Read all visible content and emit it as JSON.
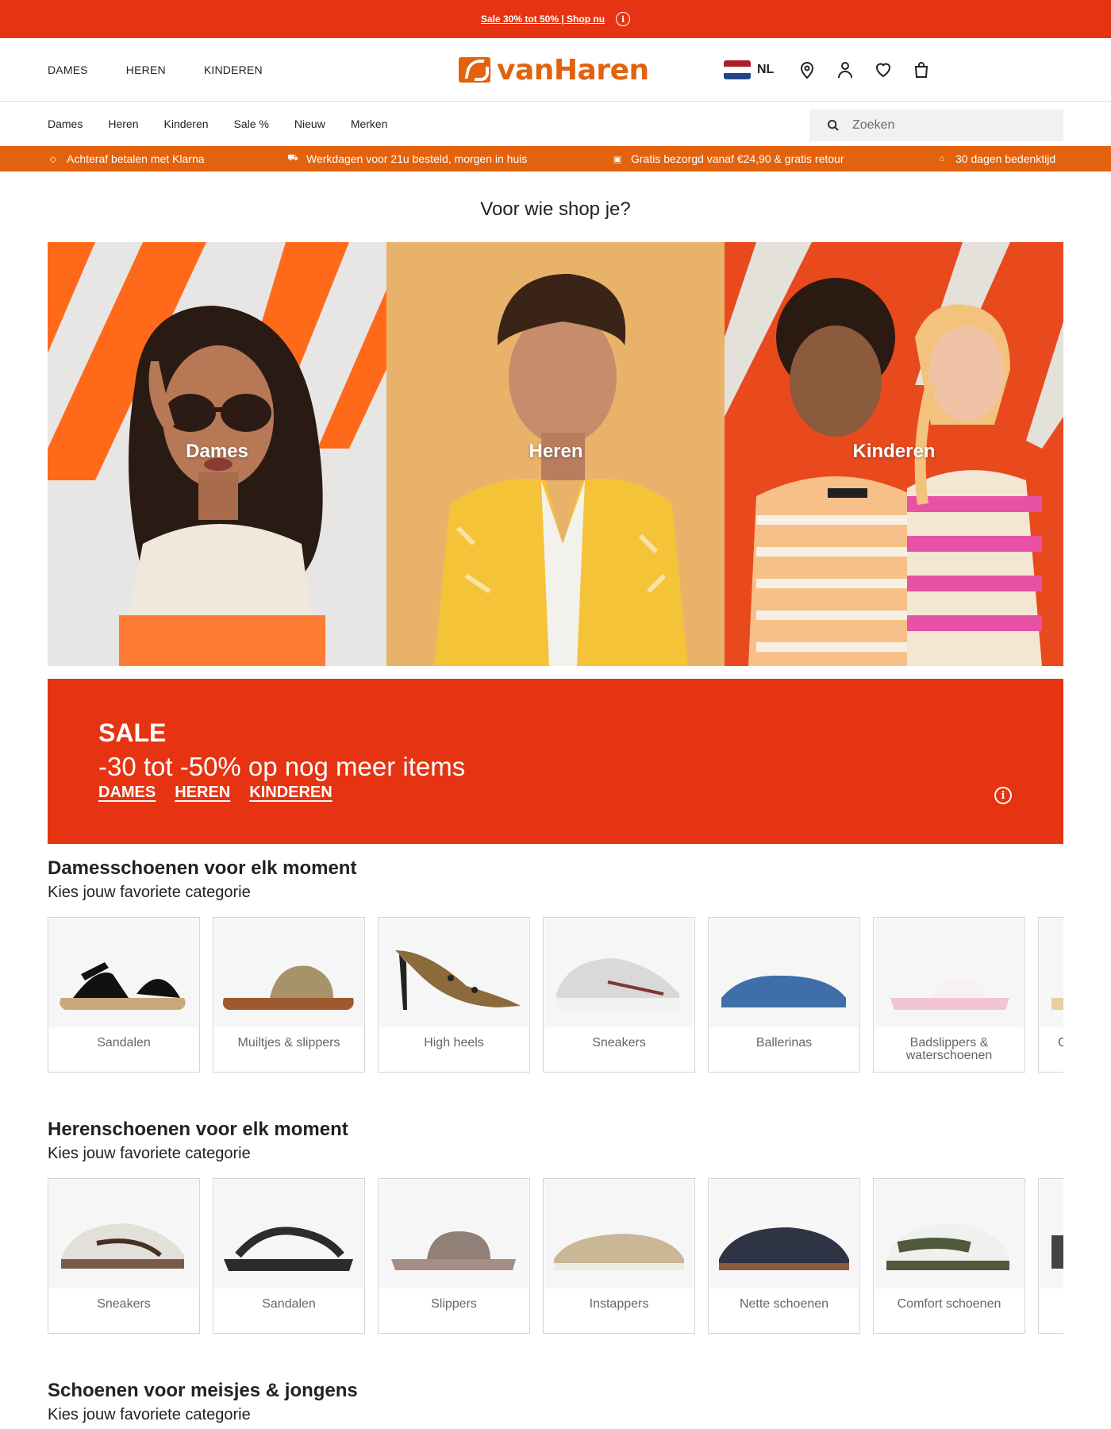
{
  "promo": {
    "text": "Sale 30% tot 50% | Shop nu"
  },
  "header": {
    "main_nav": [
      "DAMES",
      "HEREN",
      "KINDEREN"
    ],
    "logo_text": "vanHaren",
    "lang": "NL"
  },
  "subnav": {
    "items": [
      "Dames",
      "Heren",
      "Kinderen",
      "Sale %",
      "Nieuw",
      "Merken"
    ],
    "search_placeholder": "Zoeken"
  },
  "usp": [
    {
      "icon": "tag-icon",
      "text": "Achteraf betalen met Klarna"
    },
    {
      "icon": "truck-icon",
      "text": "Werkdagen voor 21u besteld, morgen in huis"
    },
    {
      "icon": "gift-icon",
      "text": "Gratis bezorgd vanaf €24,90 & gratis retour"
    },
    {
      "icon": "bag-icon",
      "text": "30 dagen bedenktijd"
    }
  ],
  "hero": {
    "title": "Voor wie shop je?",
    "tiles": [
      "Dames",
      "Heren",
      "Kinderen"
    ]
  },
  "sale": {
    "title": "SALE",
    "subtitle": "-30 tot -50% op nog meer items",
    "links": [
      "DAMES",
      "HEREN",
      "KINDEREN"
    ]
  },
  "sections": [
    {
      "title": "Damesschoenen voor elk moment",
      "subtitle": "Kies jouw favoriete categorie",
      "cards": [
        "Sandalen",
        "Muiltjes & slippers",
        "High heels",
        "Sneakers",
        "Ballerinas",
        "Badslippers & waterschoenen",
        "G"
      ]
    },
    {
      "title": "Herenschoenen voor elk moment",
      "subtitle": "Kies jouw favoriete categorie",
      "cards": [
        "Sneakers",
        "Sandalen",
        "Slippers",
        "Instappers",
        "Nette schoenen",
        "Comfort schoenen",
        ""
      ]
    },
    {
      "title": "Schoenen voor meisjes & jongens",
      "subtitle": "Kies jouw favoriete categorie",
      "cards": []
    }
  ],
  "colors": {
    "red": "#e63312",
    "orange": "#e2620e",
    "flag": [
      "#ae1c28",
      "#ffffff",
      "#21468b"
    ]
  }
}
